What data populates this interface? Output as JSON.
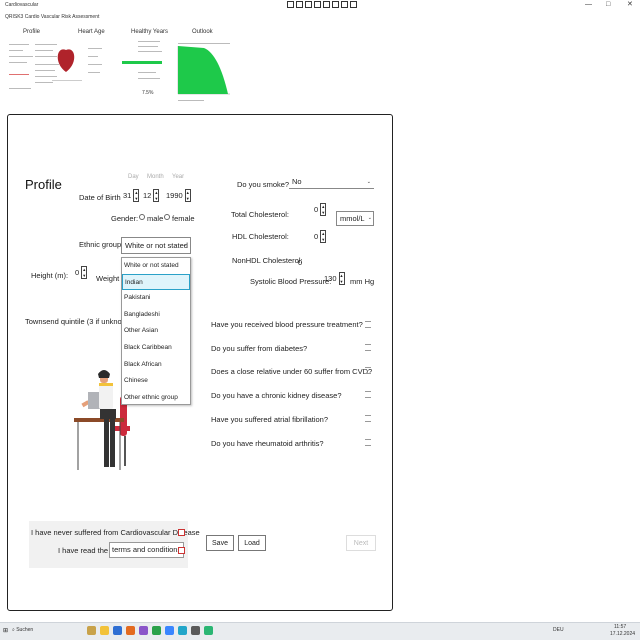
{
  "window": {
    "title": "Cardiovascular",
    "minimize": "—",
    "maximize": "□",
    "close": "✕"
  },
  "app": {
    "subtitle": "QRISK3 Cardio Vascular Risk Assessment"
  },
  "thumbnails": [
    {
      "label": "Profile"
    },
    {
      "label": "Heart Age"
    },
    {
      "label": "Healthy Years"
    },
    {
      "label": "Outlook"
    }
  ],
  "thumb_healthy": {
    "value": "7.5%"
  },
  "profile": {
    "heading": "Profile",
    "date_of_birth_label": "Date of Birth",
    "day_hint": "Day",
    "month_hint": "Month",
    "year_hint": "Year",
    "day": "31",
    "month": "12",
    "year": "1990",
    "gender_label": "Gender:",
    "gender_male": "male",
    "gender_female": "female",
    "ethnic_label": "Ethnic group",
    "ethnic_value": "White or not stated",
    "height_label": "Height (m):",
    "height_value": "0",
    "weight_label": "Weight (",
    "townsend_label": "Townsend quintile (3 if unknown)"
  },
  "ethnic_options": [
    "White or not stated",
    "Indian",
    "Pakistani",
    "Bangladeshi",
    "Other Asian",
    "Black Caribbean",
    "Black African",
    "Chinese",
    "Other ethnic group"
  ],
  "ethnic_highlighted_index": 1,
  "health": {
    "smoke_label": "Do you smoke?",
    "smoke_value": "No",
    "total_chol_label": "Total Cholesterol:",
    "total_chol_value": "0",
    "unit_value": "mmol/L",
    "hdl_label": "HDL Cholesterol:",
    "hdl_value": "0",
    "nonhdl_label": "NonHDL Cholesterol:",
    "nonhdl_value": "0",
    "systolic_label": "Systolic Blood Pressure:",
    "systolic_value": "130",
    "systolic_unit": "mm Hg"
  },
  "questions": [
    "Have you received blood pressure treatment?",
    "Do you suffer from diabetes?",
    "Does a close relative under 60 suffer from CVD?",
    "Do you have a chronic kidney disease?",
    "Have you suffered atrial fibrillation?",
    "Do you have rheumatoid arthritis?"
  ],
  "consent": {
    "never_suffered": "I have never suffered from Cardiovascular Disease",
    "have_read": "I have read the",
    "terms_link": "terms and conditions"
  },
  "buttons": {
    "save": "Save",
    "load": "Load",
    "next": "Next"
  },
  "taskbar": {
    "search": "Suchen",
    "lang": "DEU",
    "time": "11:57",
    "date": "17.12.2024"
  },
  "colors": {
    "accent_green": "#1ec94a",
    "highlight_blue": "#2aa1c8",
    "checkbox_red": "#cc3333"
  }
}
